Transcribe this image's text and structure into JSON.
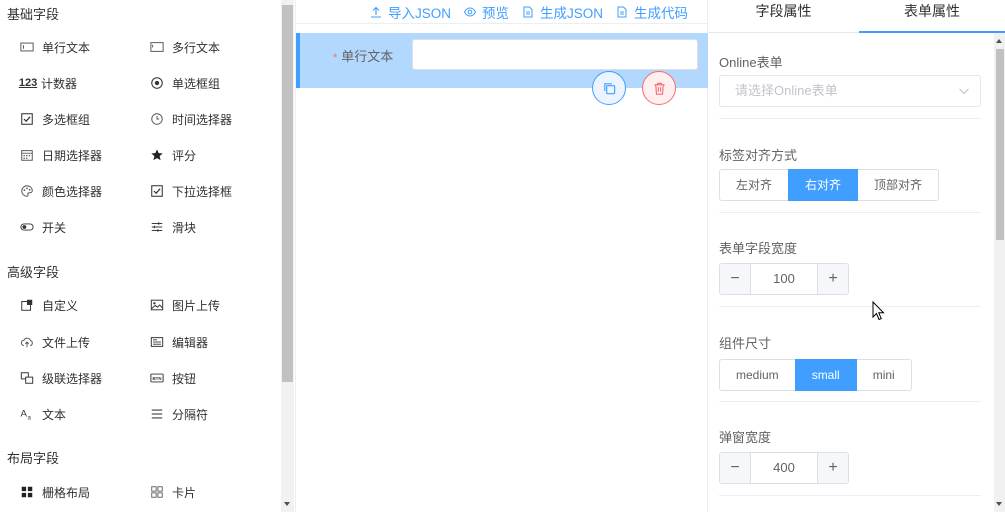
{
  "palette": {
    "groups": [
      {
        "title": "基础字段"
      },
      {
        "title": "高级字段"
      },
      {
        "title": "布局字段"
      }
    ],
    "basic": [
      {
        "label": "单行文本",
        "icon": "input-icon"
      },
      {
        "label": "多行文本",
        "icon": "textarea-icon"
      },
      {
        "label": "计数器",
        "icon": "number-icon",
        "glyph": "123"
      },
      {
        "label": "单选框组",
        "icon": "radio-icon"
      },
      {
        "label": "多选框组",
        "icon": "checkbox-icon"
      },
      {
        "label": "时间选择器",
        "icon": "clock-icon"
      },
      {
        "label": "日期选择器",
        "icon": "calendar-icon"
      },
      {
        "label": "评分",
        "icon": "star-icon"
      },
      {
        "label": "颜色选择器",
        "icon": "palette-icon"
      },
      {
        "label": "下拉选择框",
        "icon": "select-icon"
      },
      {
        "label": "开关",
        "icon": "switch-icon"
      },
      {
        "label": "滑块",
        "icon": "slider-icon"
      }
    ],
    "advanced": [
      {
        "label": "自定义",
        "icon": "custom-icon"
      },
      {
        "label": "图片上传",
        "icon": "image-icon"
      },
      {
        "label": "文件上传",
        "icon": "upload-icon"
      },
      {
        "label": "编辑器",
        "icon": "editor-icon"
      },
      {
        "label": "级联选择器",
        "icon": "cascader-icon"
      },
      {
        "label": "按钮",
        "icon": "button-icon"
      },
      {
        "label": "文本",
        "icon": "text-icon"
      },
      {
        "label": "分隔符",
        "icon": "divider-icon"
      }
    ],
    "layout": [
      {
        "label": "栅格布局",
        "icon": "grid-icon"
      },
      {
        "label": "卡片",
        "icon": "card-icon"
      }
    ]
  },
  "toolbar": {
    "import_json": "导入JSON",
    "preview": "预览",
    "gen_json": "生成JSON",
    "gen_code": "生成代码"
  },
  "canvas": {
    "field_label": "单行文本",
    "required_mark": "*"
  },
  "tabs": {
    "field_props": "字段属性",
    "form_props": "表单属性",
    "active": "表单属性"
  },
  "form_props": {
    "online_label": "Online表单",
    "online_placeholder": "请选择Online表单",
    "align_label": "标签对齐方式",
    "align_options": [
      "左对齐",
      "右对齐",
      "顶部对齐"
    ],
    "align_selected": "右对齐",
    "width_label": "表单字段宽度",
    "width_value": "100",
    "size_label": "组件尺寸",
    "size_options": [
      "medium",
      "small",
      "mini"
    ],
    "size_selected": "small",
    "dialog_label": "弹窗宽度",
    "dialog_value": "400",
    "minus": "−",
    "plus": "+"
  },
  "colors": {
    "primary": "#409eff",
    "selected_bg": "#b3d8fd",
    "danger": "#f56c6c"
  }
}
